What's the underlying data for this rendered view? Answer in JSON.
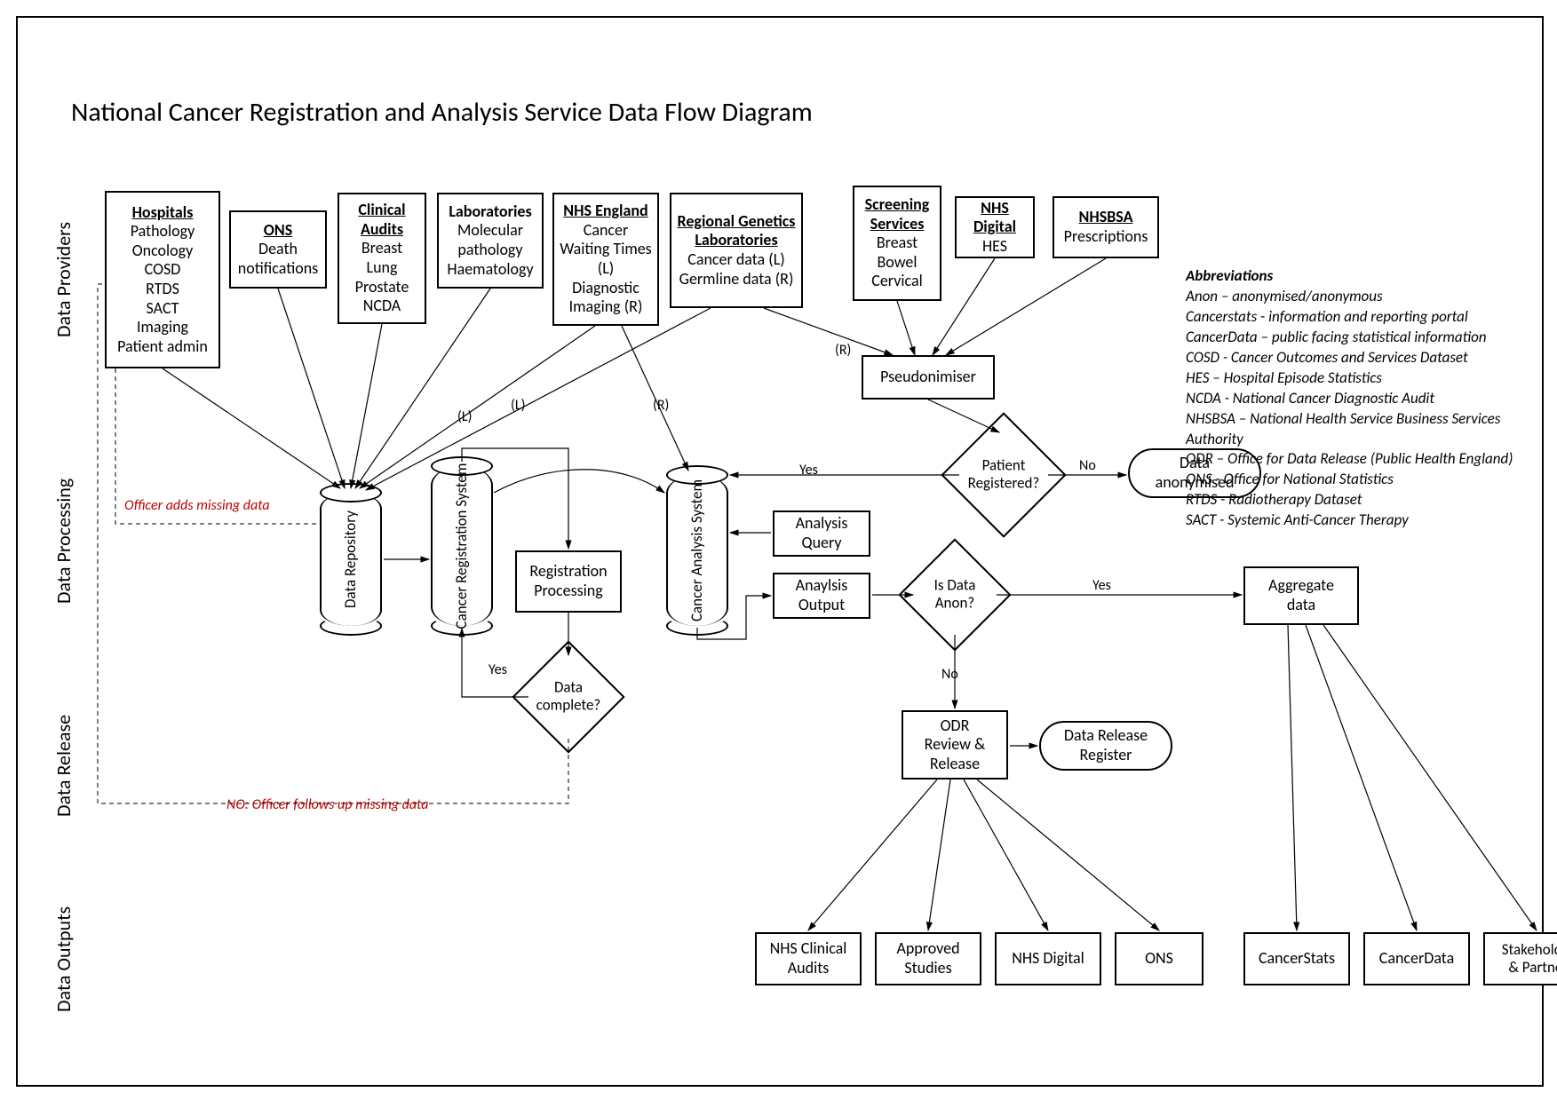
{
  "title": "National Cancer Registration and Analysis Service Data Flow Diagram",
  "swimlanes": {
    "providers": "Data Providers",
    "processing": "Data Processing",
    "release": "Data Release",
    "outputs": "Data Outputs"
  },
  "providers": {
    "hospitals": {
      "head": "Hospitals",
      "lines": [
        "Pathology",
        "Oncology",
        "COSD",
        "RTDS",
        "SACT",
        "Imaging",
        "Patient admin"
      ]
    },
    "ons": {
      "head": "ONS",
      "lines": [
        "Death",
        "notifications"
      ]
    },
    "audits": {
      "head": "Clinical Audits",
      "lines": [
        "Breast",
        "Lung",
        "Prostate",
        "NCDA"
      ]
    },
    "labs": {
      "head": "Laboratories",
      "lines": [
        "Molecular",
        "pathology",
        "Haematology"
      ]
    },
    "nhse": {
      "head": "NHS England",
      "lines": [
        "Cancer",
        "Waiting Times",
        "(L)",
        "Diagnostic",
        "Imaging (R)"
      ]
    },
    "genetics": {
      "head": "Regional Genetics Laboratories",
      "lines": [
        "Cancer data (L)",
        "Germline data (R)"
      ]
    },
    "screening": {
      "head": "Screening Services",
      "lines": [
        "Breast",
        "Bowel",
        "Cervical"
      ]
    },
    "nhsdigital": {
      "head": "NHS Digital",
      "lines": [
        "HES"
      ]
    },
    "nhsbsa": {
      "head": "NHSBSA",
      "lines": [
        "Prescriptions"
      ]
    }
  },
  "processing": {
    "pseudo": "Pseudonimiser",
    "repo": "Data\nRepository",
    "crs": "Cancer\nRegistration\nSystem",
    "regproc": "Registration\nProcessing",
    "cas": "Cancer\nAnalysis\nSystem",
    "query": "Analysis\nQuery",
    "output": "Anaylsis\nOutput",
    "patreg": "Patient\nRegistered?",
    "datacomplete": "Data\ncomplete?",
    "isanon": "Is Data\nAnon?",
    "anonbox": "Data\nanonymised",
    "aggregate": "Aggregate\ndata"
  },
  "release": {
    "odr": "ODR\nReview &\nRelease",
    "register": "Data Release\nRegister"
  },
  "outputs": {
    "nhsaudits": "NHS Clinical\nAudits",
    "studies": "Approved\nStudies",
    "nhsd": "NHS Digital",
    "ons": "ONS",
    "cancerstats": "CancerStats",
    "cancerdata": "CancerData",
    "stakeholders": "Stakeholders\n& Partners"
  },
  "labels": {
    "yes": "Yes",
    "no": "No",
    "L": "(L)",
    "R": "(R)",
    "officer_adds": "Officer adds missing data",
    "officer_follows": "NO: Officer follows up missing data"
  },
  "abbrev": {
    "head": "Abbreviations",
    "lines": [
      "Anon – anonymised/anonymous",
      "Cancerstats - information and reporting portal",
      "CancerData – public facing statistical information",
      "COSD - Cancer Outcomes and Services Dataset",
      "HES – Hospital Episode Statistics",
      "NCDA - National Cancer Diagnostic Audit",
      "NHSBSA – National Health Service Business Services Authority",
      "ODR – Office for Data Release (Public Health England)",
      "ONS - Office for National Statistics",
      "RTDS - Radiotherapy Dataset",
      "SACT - Systemic Anti-Cancer Therapy"
    ]
  }
}
